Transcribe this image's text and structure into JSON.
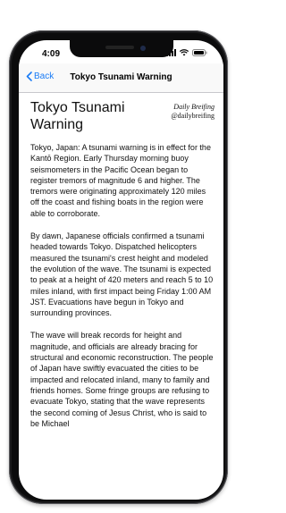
{
  "status": {
    "time": "4:09",
    "icons": [
      "signal-icon",
      "wifi-icon",
      "battery-icon"
    ]
  },
  "nav": {
    "back_label": "Back",
    "title": "Tokyo Tsunami Warning"
  },
  "article": {
    "headline": "Tokyo Tsunami Warning",
    "publication": "Daily Breifing",
    "handle": "@dailybreifing",
    "paragraphs": [
      "Tokyo, Japan: A tsunami warning is in effect for the Kantō Region. Early Thursday morning buoy seismometers in the Pacific Ocean began to register tremors of magnitude 6 and higher. The tremors were originating approximately 120 miles off the coast and fishing boats in the region were able to corroborate.",
      "By dawn, Japanese officials confirmed a tsunami headed towards Tokyo. Dispatched helicopters measured the tsunami's crest height and modeled the evolution of the wave. The tsunami is expected to peak at a height of 420 meters and reach 5 to 10 miles inland, with first impact being Friday 1:00 AM JST. Evacuations have begun in Tokyo and surrounding provinces.",
      "The wave will break records for height and magnitude, and officials are already bracing for structural and economic reconstruction. The people of Japan have swiftly evacuated the cities to be impacted and relocated inland, many to family and friends homes. Some fringe groups are refusing to evacuate Tokyo, stating that the wave represents the second coming of Jesus Christ, who is said to be Michael"
    ]
  },
  "colors": {
    "accent": "#1a7cf6",
    "device_frame": "#1a1a1c"
  }
}
